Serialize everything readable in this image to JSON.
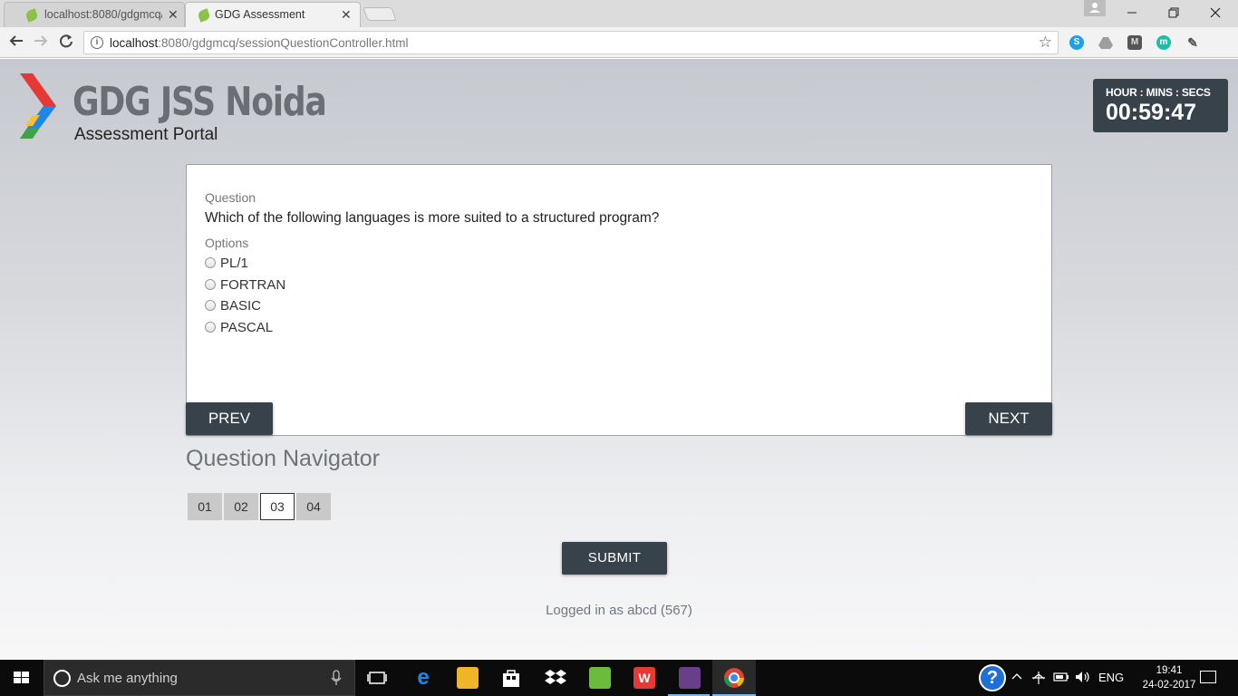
{
  "browser": {
    "tabs": [
      {
        "label": "localhost:8080/gdgmcq/",
        "active": false
      },
      {
        "label": "GDG Assessment",
        "active": true
      }
    ],
    "close_glyph": "✕",
    "url_host": "localhost",
    "url_rest": ":8080/gdgmcq/sessionQuestionController.html",
    "extensions": [
      "skype-icon",
      "drive-icon",
      "m-badge-icon",
      "m-circle-icon",
      "brush-icon"
    ]
  },
  "header": {
    "brand": "GDG JSS Noida",
    "subtitle": "Assessment Portal"
  },
  "timer": {
    "label": "HOUR : MINS : SECS",
    "value": "00:59:47"
  },
  "question": {
    "section_label": "Question",
    "text": "Which of the following languages is more suited to a structured program?",
    "options_label": "Options",
    "options": [
      "PL/1",
      "FORTRAN",
      "BASIC",
      "PASCAL"
    ],
    "prev_label": "PREV",
    "next_label": "NEXT"
  },
  "navigator": {
    "title": "Question Navigator",
    "items": [
      "01",
      "02",
      "03",
      "04"
    ],
    "current": "03"
  },
  "submit_label": "SUBMIT",
  "logged_in": "Logged in as abcd (567)",
  "taskbar": {
    "search_placeholder": "Ask me anything",
    "language": "ENG",
    "time": "19:41",
    "date": "24-02-2017"
  },
  "colors": {
    "dark_panel": "#37424a",
    "page_bg_top": "#c6c9cf",
    "page_bg_bottom": "#f7f7f8"
  }
}
